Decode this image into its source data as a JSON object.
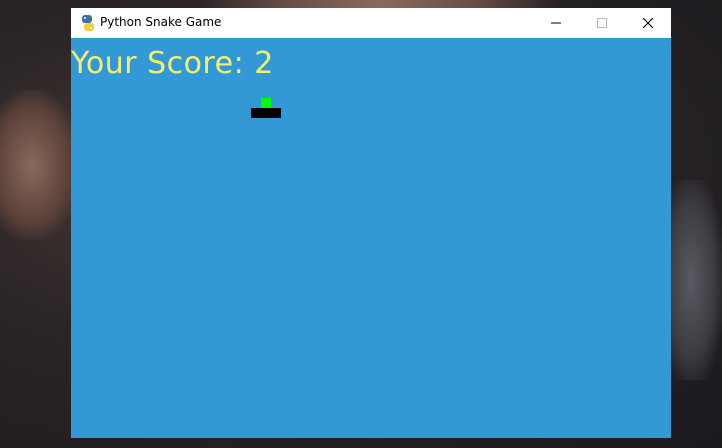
{
  "window": {
    "title": "Python Snake Game",
    "controls": [
      "minimize",
      "maximize",
      "close"
    ]
  },
  "game": {
    "score_label": "Your Score: 2",
    "score": 2,
    "snake_length": 3,
    "colors": {
      "background": "#3399d6",
      "score_text": "#f5ef6e",
      "snake": "#000000",
      "food": "#00ff00"
    }
  },
  "icons": {
    "app": "python-icon",
    "minimize": "minimize-icon",
    "maximize": "maximize-icon",
    "close": "close-icon"
  }
}
